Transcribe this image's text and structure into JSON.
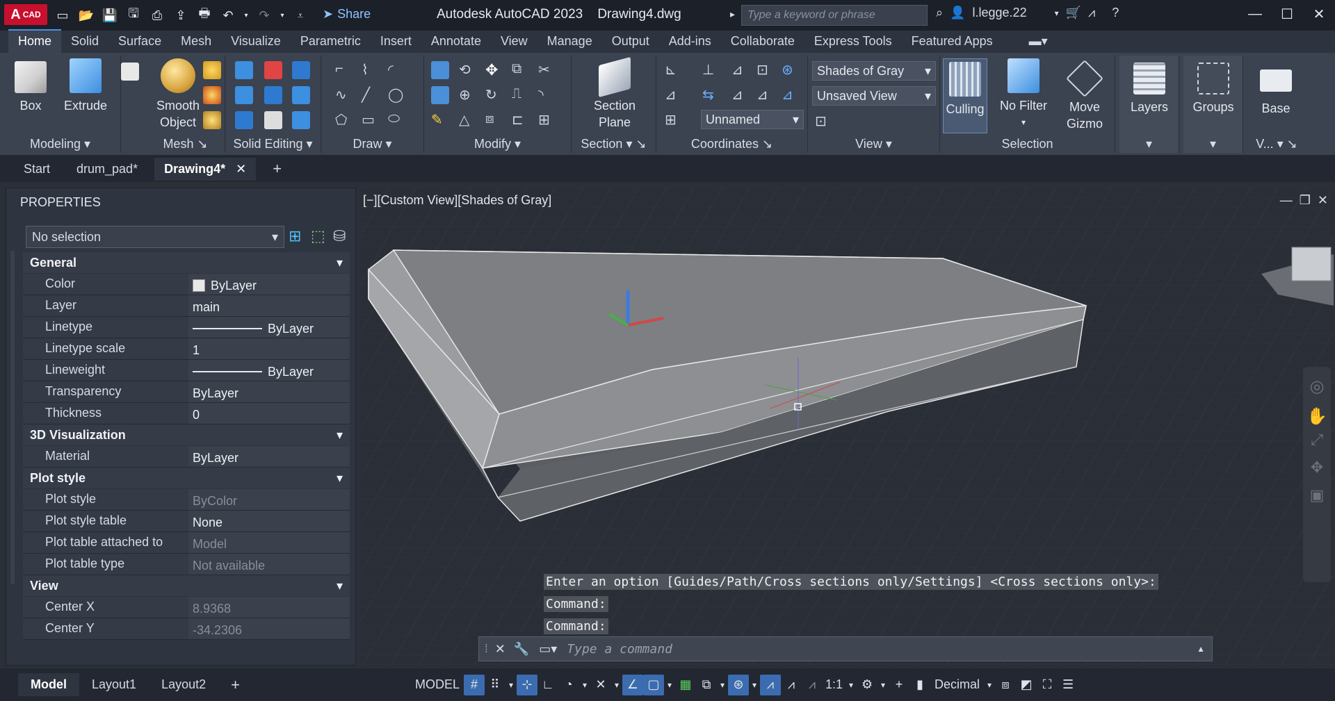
{
  "titlebar": {
    "app_logo": "CAD",
    "share_label": "Share",
    "app_title": "Autodesk AutoCAD 2023",
    "doc_title": "Drawing4.dwg",
    "search_placeholder": "Type a keyword or phrase",
    "user_name": "l.legge.22"
  },
  "ribbon_tabs": [
    "Home",
    "Solid",
    "Surface",
    "Mesh",
    "Visualize",
    "Parametric",
    "Insert",
    "Annotate",
    "View",
    "Manage",
    "Output",
    "Add-ins",
    "Collaborate",
    "Express Tools",
    "Featured Apps"
  ],
  "ribbon": {
    "modeling": {
      "label": "Modeling",
      "box": "Box",
      "extrude": "Extrude"
    },
    "mesh": {
      "label": "Mesh",
      "smooth": "Smooth\nObject"
    },
    "solid_editing": {
      "label": "Solid Editing"
    },
    "draw": {
      "label": "Draw"
    },
    "modify": {
      "label": "Modify"
    },
    "section": {
      "label": "Section",
      "plane": "Section\nPlane"
    },
    "coordinates": {
      "label": "Coordinates",
      "ucs_name": "Unnamed"
    },
    "view": {
      "label": "View",
      "visual_style": "Shades of Gray",
      "saved_view": "Unsaved View"
    },
    "selection": {
      "label": "Selection",
      "culling": "Culling",
      "no_filter": "No Filter",
      "move_gizmo": "Move\nGizmo"
    },
    "layers": {
      "label": "Layers"
    },
    "groups": {
      "label": "Groups"
    },
    "base": {
      "label": "Base",
      "sub": "V..."
    }
  },
  "file_tabs": [
    "Start",
    "drum_pad*",
    "Drawing4*"
  ],
  "properties": {
    "title": "PROPERTIES",
    "selection": "No selection",
    "sections": [
      {
        "name": "General",
        "rows": [
          {
            "key": "Color",
            "value": "ByLayer",
            "swatch": true
          },
          {
            "key": "Layer",
            "value": "main"
          },
          {
            "key": "Linetype",
            "value": "ByLayer",
            "line": true
          },
          {
            "key": "Linetype scale",
            "value": "1"
          },
          {
            "key": "Lineweight",
            "value": "ByLayer",
            "line": true
          },
          {
            "key": "Transparency",
            "value": "ByLayer"
          },
          {
            "key": "Thickness",
            "value": "0"
          }
        ]
      },
      {
        "name": "3D Visualization",
        "rows": [
          {
            "key": "Material",
            "value": "ByLayer"
          }
        ]
      },
      {
        "name": "Plot style",
        "rows": [
          {
            "key": "Plot style",
            "value": "ByColor",
            "dim": true
          },
          {
            "key": "Plot style table",
            "value": "None"
          },
          {
            "key": "Plot table attached to",
            "value": "Model",
            "dim": true
          },
          {
            "key": "Plot table type",
            "value": "Not available",
            "dim": true
          }
        ]
      },
      {
        "name": "View",
        "rows": [
          {
            "key": "Center X",
            "value": "8.9368",
            "dim": true
          },
          {
            "key": "Center Y",
            "value": "-34.2306",
            "dim": true
          }
        ]
      }
    ]
  },
  "viewport": {
    "label": "[−][Custom View][Shades of Gray]"
  },
  "command": {
    "history": [
      "Enter an option [Guides/Path/Cross sections only/Settings] <Cross sections only>:",
      "Command:",
      "Command:"
    ],
    "placeholder": "Type a command"
  },
  "statusbar": {
    "tabs": [
      "Model",
      "Layout1",
      "Layout2"
    ],
    "model_label": "MODEL",
    "scale": "1:1",
    "units": "Decimal"
  },
  "colors": {
    "accent": "#4a90e2",
    "logo": "#c8102e",
    "bg": "#2a2e36"
  }
}
